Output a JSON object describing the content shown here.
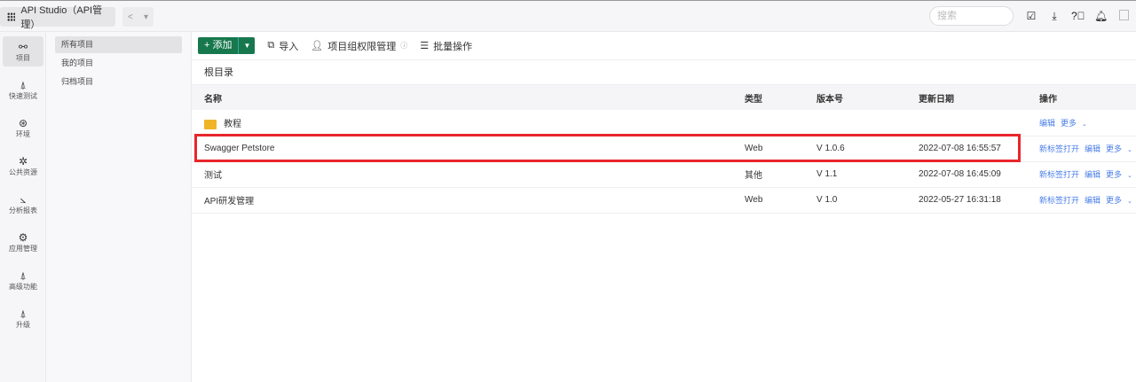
{
  "app": {
    "title": "API Studio（API管理）",
    "search_placeholder": "搜索"
  },
  "rail": [
    {
      "label": "项目",
      "icon": "project-icon"
    },
    {
      "label": "快速测试",
      "icon": "rocket-icon"
    },
    {
      "label": "环境",
      "icon": "environment-icon"
    },
    {
      "label": "公共资源",
      "icon": "puzzle-icon"
    },
    {
      "label": "分析报表",
      "icon": "chart-icon"
    },
    {
      "label": "应用管理",
      "icon": "gear-icon"
    },
    {
      "label": "高级功能",
      "icon": "rocket-icon"
    },
    {
      "label": "升级",
      "icon": "rocket-icon"
    }
  ],
  "subnav": [
    "所有项目",
    "我的项目",
    "归档项目"
  ],
  "toolbar": {
    "add": "+ 添加",
    "import": "导入",
    "perm": "项目组权限管理",
    "batch": "批量操作"
  },
  "breadcrumb": "根目录",
  "table": {
    "headers": [
      "名称",
      "类型",
      "版本号",
      "更新日期",
      "操作"
    ],
    "rows": [
      {
        "name": "教程",
        "type": "",
        "version": "",
        "date": "",
        "actions": [
          "编辑",
          "更多"
        ]
      },
      {
        "name": "Swagger Petstore",
        "type": "Web",
        "version": "V 1.0.6",
        "date": "2022-07-08 16:55:57",
        "actions": [
          "新标签打开",
          "编辑",
          "更多"
        ]
      },
      {
        "name": "测试",
        "type": "其他",
        "version": "V 1.1",
        "date": "2022-07-08 16:45:09",
        "actions": [
          "新标签打开",
          "编辑",
          "更多"
        ]
      },
      {
        "name": "API研发管理",
        "type": "Web",
        "version": "V 1.0",
        "date": "2022-05-27 16:31:18",
        "actions": [
          "新标签打开",
          "编辑",
          "更多"
        ]
      }
    ]
  }
}
